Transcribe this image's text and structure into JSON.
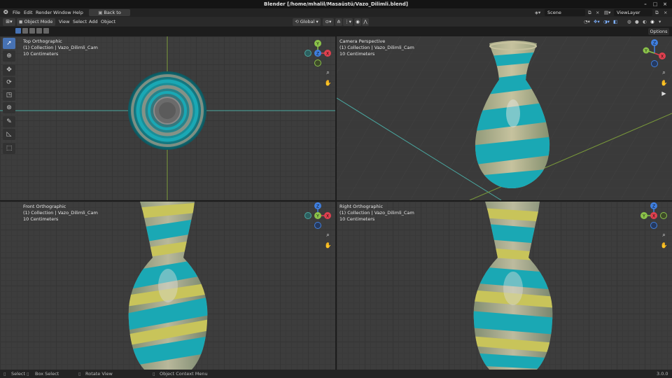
{
  "window": {
    "title": "Blender [/home/mhalil/Masaüstü/Vazo_Dilimli.blend]"
  },
  "menubar": {
    "items": [
      "File",
      "Edit",
      "Render",
      "Window",
      "Help"
    ],
    "back_button": "Back to Previous",
    "scene_label": "Scene",
    "viewlayer_label": "ViewLayer"
  },
  "viewport_header": {
    "mode": "Object Mode",
    "menus": [
      "View",
      "Select",
      "Add",
      "Object"
    ],
    "transform_orientation": "Global",
    "options_label": "Options"
  },
  "viewports": [
    {
      "name": "Top Orthographic",
      "collection": "(1) Collection | Vazo_Dilimli_Cam",
      "scale": "10 Centimeters"
    },
    {
      "name": "Camera Perspective",
      "collection": "(1) Collection | Vazo_Dilimli_Cam",
      "scale": "10 Centimeters"
    },
    {
      "name": "Front Orthographic",
      "collection": "(1) Collection | Vazo_Dilimli_Cam",
      "scale": "10 Centimeters"
    },
    {
      "name": "Right Orthographic",
      "collection": "(1) Collection | Vazo_Dilimli_Cam",
      "scale": "10 Centimeters"
    }
  ],
  "gizmo_labels": {
    "x": "X",
    "y": "Y",
    "z": "Z"
  },
  "colors": {
    "accent": "#4772b3",
    "axis_x": "#e0404f",
    "axis_y": "#8bc34a",
    "axis_z": "#3f7fe0",
    "glass_teal": "#1aa8b4",
    "glass_yellow": "#c8c45a"
  },
  "statusbar": {
    "select": "Select",
    "box_select": "Box Select",
    "rotate_view": "Rotate View",
    "context_menu": "Object Context Menu",
    "version": "3.0.0"
  }
}
